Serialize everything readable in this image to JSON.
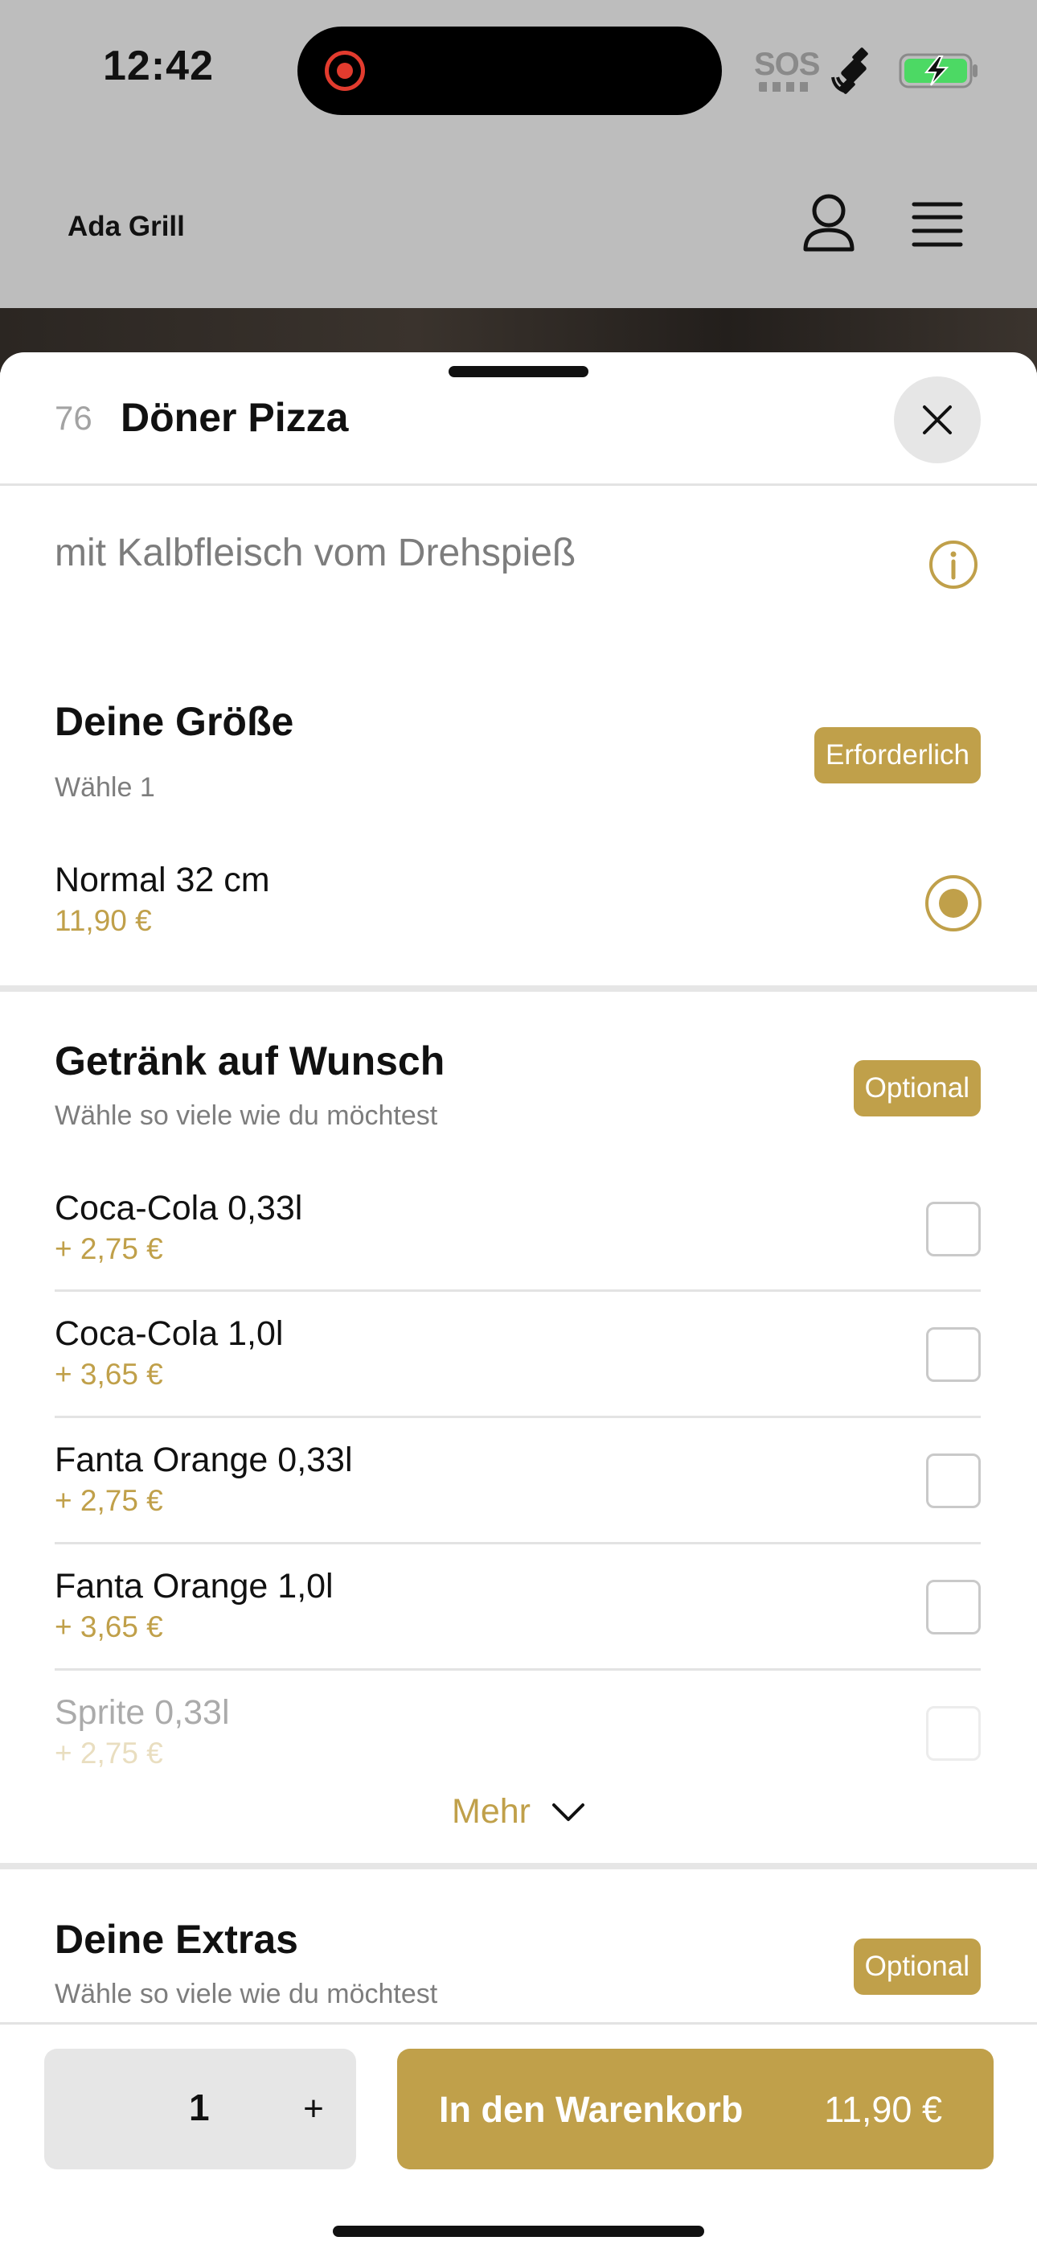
{
  "status_bar": {
    "time": "12:42",
    "sos": "SOS",
    "icons": [
      "record-icon",
      "satellite-icon",
      "battery-charging-icon"
    ],
    "battery_color": "#4cd964"
  },
  "header": {
    "brand": "Ada Grill",
    "icons": [
      "user-icon",
      "menu-icon"
    ]
  },
  "sheet": {
    "item_number": "76",
    "item_title": "Döner Pizza",
    "description": "mit Kalbfleisch vom Drehspieß",
    "accent_color": "#c0a04a"
  },
  "size_section": {
    "title": "Deine Größe",
    "subtitle": "Wähle 1",
    "badge": "Erforderlich",
    "options": [
      {
        "name": "Normal 32 cm",
        "price": "11,90 €",
        "selected": true
      }
    ]
  },
  "drink_section": {
    "title": "Getränk auf Wunsch",
    "subtitle": "Wähle so viele wie du möchtest",
    "badge": "Optional",
    "options": [
      {
        "name": "Coca-Cola 0,33l",
        "price": "+ 2,75 €",
        "checked": false
      },
      {
        "name": "Coca-Cola 1,0l",
        "price": "+ 3,65 €",
        "checked": false
      },
      {
        "name": "Fanta Orange 0,33l",
        "price": "+ 2,75 €",
        "checked": false
      },
      {
        "name": "Fanta Orange 1,0l",
        "price": "+ 3,65 €",
        "checked": false
      },
      {
        "name": "Sprite 0,33l",
        "price": "+ 2,75 €",
        "checked": false
      }
    ],
    "more_label": "Mehr"
  },
  "extras_section": {
    "title": "Deine Extras",
    "subtitle": "Wähle so viele wie du möchtest",
    "badge": "Optional"
  },
  "bottom_bar": {
    "quantity": "1",
    "plus_label": "+",
    "cart_label": "In den Warenkorb",
    "cart_price": "11,90 €"
  }
}
